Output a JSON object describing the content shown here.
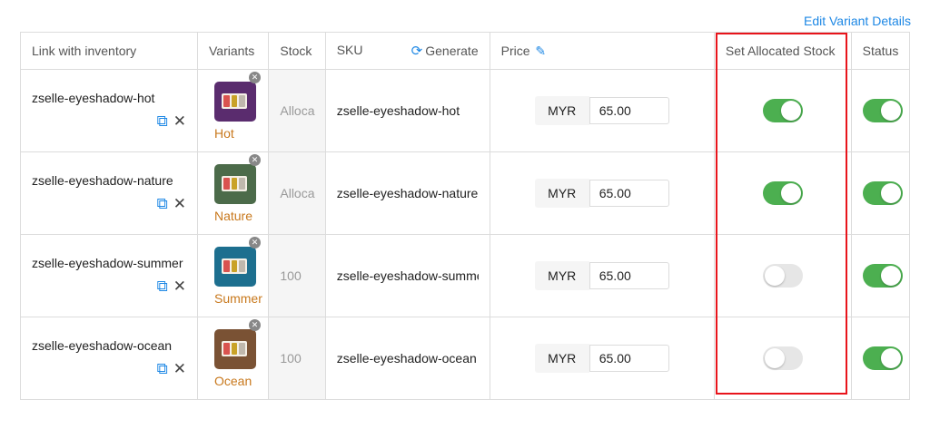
{
  "edit_variant_label": "Edit Variant Details",
  "headers": {
    "link": "Link with inventory",
    "variants": "Variants",
    "stock": "Stock",
    "sku": "SKU",
    "generate": "Generate",
    "price": "Price",
    "allocated": "Set Allocated Stock",
    "status": "Status"
  },
  "icons": {
    "refresh": "refresh-icon",
    "pencil": "pencil-icon",
    "open": "external-link-icon",
    "close": "close-icon",
    "remove": "remove-badge-icon"
  },
  "colors": {
    "accent": "#1e88e5",
    "toggle_on": "#4caf50",
    "highlight": "#e8141b",
    "variant_label": "#c8781c"
  },
  "rows": [
    {
      "link": "zselle-eyeshadow-hot",
      "variant": "Hot",
      "thumb_color": "#5a2c6e",
      "stock": "Alloca",
      "sku": "zselle-eyeshadow-hot",
      "currency": "MYR",
      "price": "65.00",
      "allocated_on": true,
      "status_on": true
    },
    {
      "link": "zselle-eyeshadow-nature",
      "variant": "Nature",
      "thumb_color": "#4c6b4a",
      "stock": "Alloca",
      "sku": "zselle-eyeshadow-nature",
      "currency": "MYR",
      "price": "65.00",
      "allocated_on": true,
      "status_on": true
    },
    {
      "link": "zselle-eyeshadow-summer",
      "variant": "Summer",
      "thumb_color": "#1d6f8f",
      "stock": "100",
      "sku": "zselle-eyeshadow-summe",
      "currency": "MYR",
      "price": "65.00",
      "allocated_on": false,
      "status_on": true
    },
    {
      "link": "zselle-eyeshadow-ocean",
      "variant": "Ocean",
      "thumb_color": "#7a5234",
      "stock": "100",
      "sku": "zselle-eyeshadow-ocean",
      "currency": "MYR",
      "price": "65.00",
      "allocated_on": false,
      "status_on": true
    }
  ]
}
